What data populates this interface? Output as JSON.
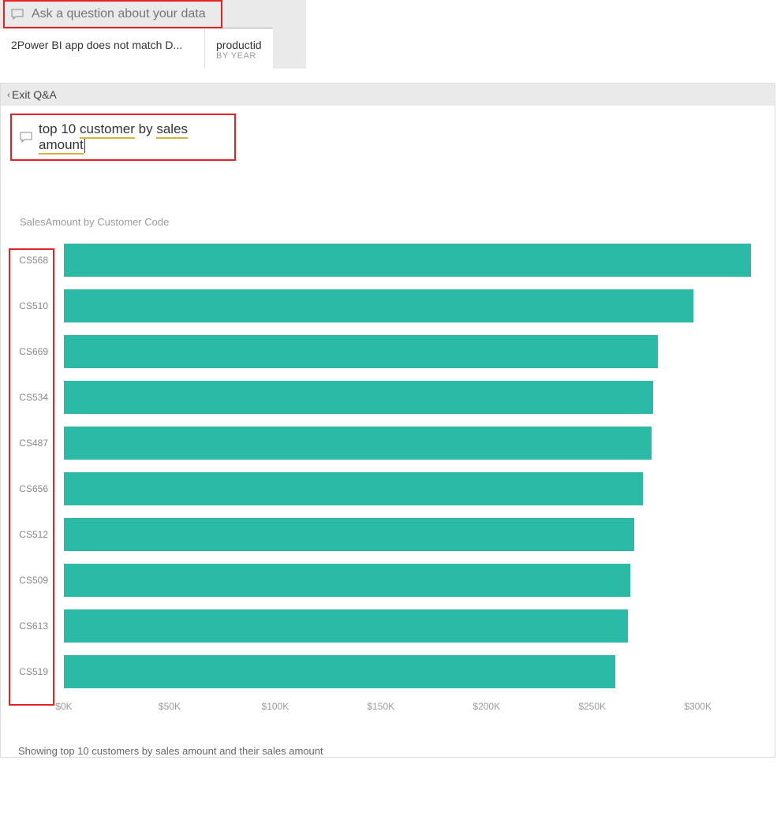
{
  "ask_placeholder": "Ask a question about your data",
  "tabs": [
    {
      "label": "2Power BI app does not match D...",
      "sub": ""
    },
    {
      "label": "productid",
      "sub": "BY YEAR"
    }
  ],
  "exit_label": "Exit Q&A",
  "query": {
    "prefix": "top 10 ",
    "term1": "customer",
    "mid": " by ",
    "term2": "sales amount"
  },
  "chart_title": "SalesAmount by Customer Code",
  "footer": "Showing top 10 customers by sales amount and their sales amount",
  "xlabel_prefix": "$",
  "xlabel_suffix": "K",
  "chart_data": {
    "type": "bar",
    "orientation": "horizontal",
    "title": "SalesAmount by Customer Code",
    "xlabel": "SalesAmount",
    "ylabel": "Customer Code",
    "categories": [
      "CS568",
      "CS510",
      "CS669",
      "CS534",
      "CS487",
      "CS656",
      "CS512",
      "CS509",
      "CS613",
      "CS519"
    ],
    "values": [
      325000,
      298000,
      281000,
      279000,
      278000,
      274000,
      270000,
      268000,
      267000,
      261000
    ],
    "xlim": [
      0,
      330000
    ],
    "xticks": [
      0,
      50000,
      100000,
      150000,
      200000,
      250000,
      300000
    ],
    "bar_color": "#2bbaa5"
  }
}
